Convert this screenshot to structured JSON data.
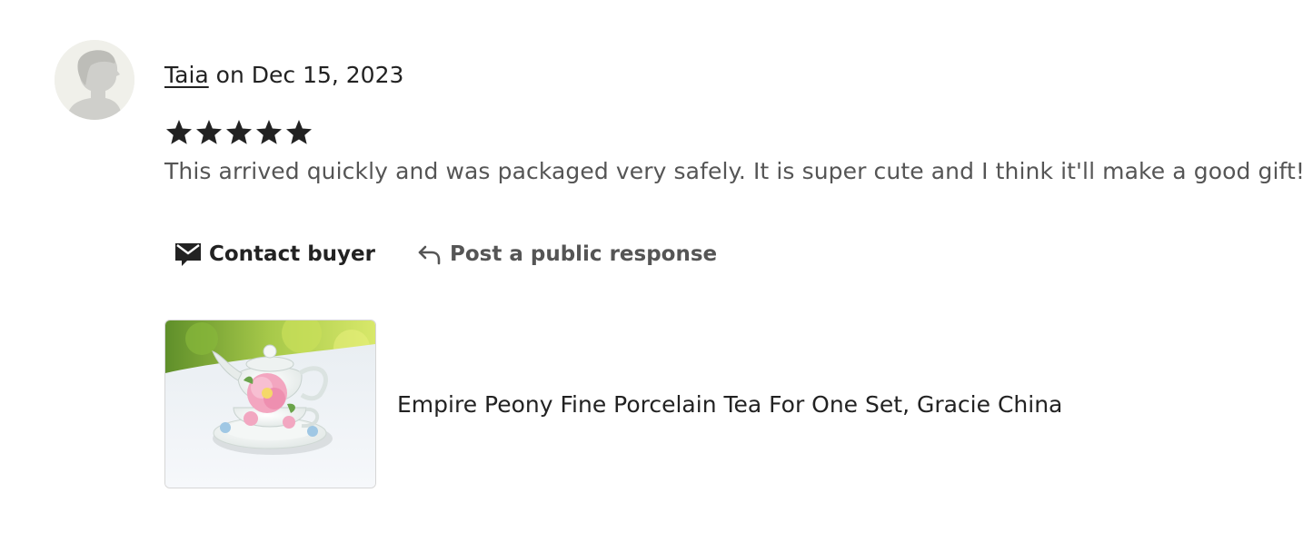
{
  "review": {
    "reviewer_name": "Taia",
    "date_text": " on Dec 15, 2023",
    "rating": 5,
    "rating_max": 5,
    "text": "This arrived quickly and was packaged very safely. It is super cute and I think it'll make a good gift!"
  },
  "actions": {
    "contact_label": "Contact buyer",
    "contact_icon": "mail-icon",
    "respond_label": "Post a public response",
    "respond_icon": "reply-arrow-icon"
  },
  "listing": {
    "title": "Empire Peony Fine Porcelain Tea For One Set, Gracie China"
  },
  "colors": {
    "text_primary": "#222222",
    "text_secondary": "#555555",
    "avatar_bg": "#f0f0ea"
  }
}
